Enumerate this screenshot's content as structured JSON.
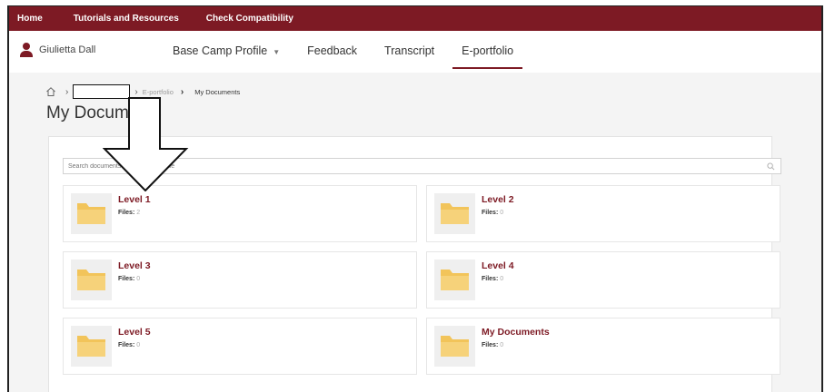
{
  "topnav": {
    "home": "Home",
    "tutorials": "Tutorials and Resources",
    "compat": "Check Compatibility"
  },
  "user": {
    "name": "Giulietta Dall"
  },
  "tabs": {
    "base_camp": "Base Camp Profile",
    "feedback": "Feedback",
    "transcript": "Transcript",
    "eportfolio": "E-portfolio"
  },
  "breadcrumb": {
    "link": "E-portfolio",
    "current": "My Documents"
  },
  "page": {
    "title": "My Documents"
  },
  "search": {
    "placeholder": "Search documents and folders by title"
  },
  "folders": [
    {
      "name": "Level 1",
      "files_label": "Files:",
      "files": "2"
    },
    {
      "name": "Level 2",
      "files_label": "Files:",
      "files": "0"
    },
    {
      "name": "Level 3",
      "files_label": "Files:",
      "files": "0"
    },
    {
      "name": "Level 4",
      "files_label": "Files:",
      "files": "0"
    },
    {
      "name": "Level 5",
      "files_label": "Files:",
      "files": "0"
    },
    {
      "name": "My Documents",
      "files_label": "Files:",
      "files": "0"
    }
  ],
  "colors": {
    "brand": "#7d1a24",
    "folder": "#f2c45a"
  }
}
